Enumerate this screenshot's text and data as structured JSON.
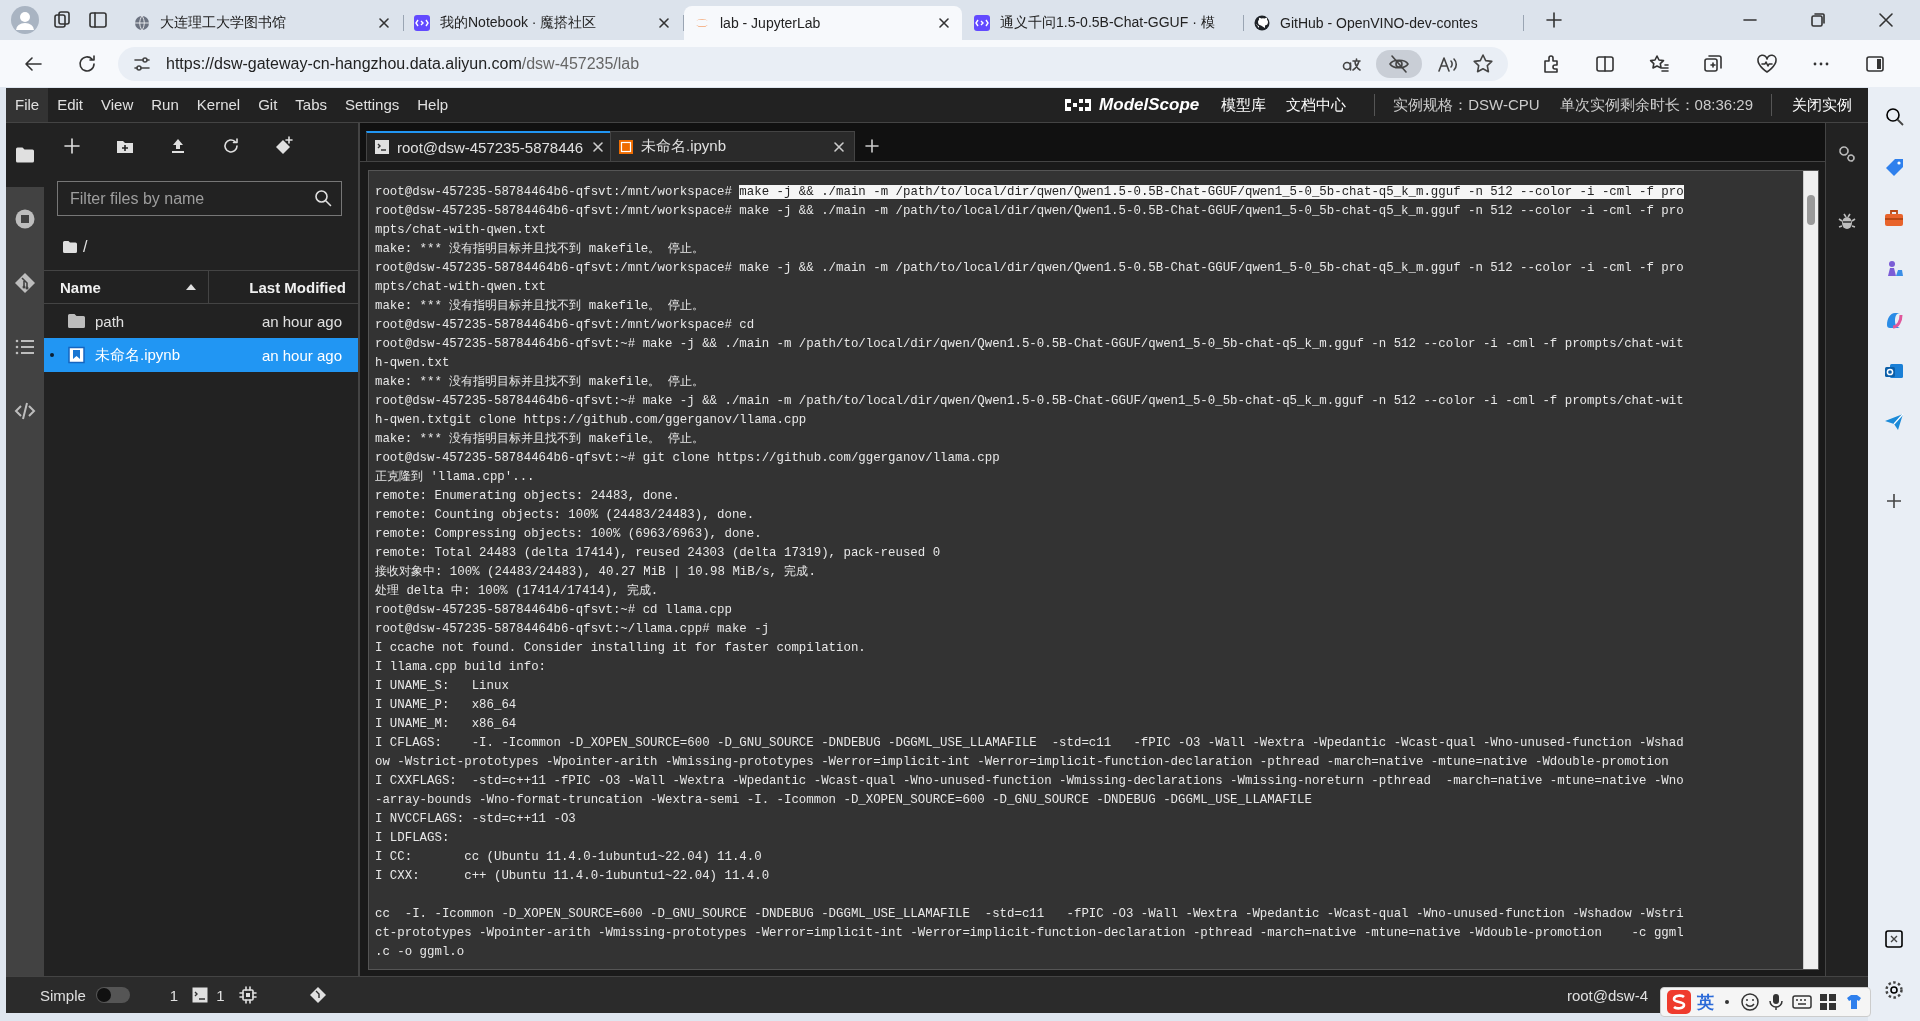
{
  "browser": {
    "tabs": [
      {
        "kind": "globe",
        "title": "大连理工大学图书馆",
        "selected": false,
        "closable": true
      },
      {
        "kind": "modelscope",
        "title": "我的Notebook · 魔搭社区",
        "selected": false,
        "closable": true
      },
      {
        "kind": "jupyter",
        "title": "lab - JupyterLab",
        "selected": true,
        "closable": true
      },
      {
        "kind": "modelscope",
        "title": "通义千问1.5-0.5B-Chat-GGUF · 模",
        "selected": false,
        "closable": false
      },
      {
        "kind": "github",
        "title": "GitHub - OpenVINO-dev-contes",
        "selected": false,
        "closable": false
      }
    ],
    "address": {
      "host": "https://dsw-gateway-cn-hangzhou.data.aliyun.com",
      "path": "/dsw-457235/lab"
    }
  },
  "menubar": {
    "items": [
      {
        "label": "File",
        "selected": true
      },
      {
        "label": "Edit",
        "selected": false
      },
      {
        "label": "View",
        "selected": false
      },
      {
        "label": "Run",
        "selected": false
      },
      {
        "label": "Kernel",
        "selected": false
      },
      {
        "label": "Git",
        "selected": false
      },
      {
        "label": "Tabs",
        "selected": false
      },
      {
        "label": "Settings",
        "selected": false
      },
      {
        "label": "Help",
        "selected": false
      }
    ],
    "brand": "ModelScope",
    "links": [
      "模型库",
      "文档中心"
    ],
    "instance_spec": "实例规格：DSW-CPU",
    "remaining_time": "单次实例剩余时长：08:36:29",
    "close_button": "关闭实例"
  },
  "left_sidebar": {
    "items": [
      {
        "kind": "folder",
        "selected": true
      },
      {
        "kind": "stop",
        "selected": false
      },
      {
        "kind": "git",
        "selected": false
      },
      {
        "kind": "list",
        "selected": false
      },
      {
        "kind": "code",
        "selected": false
      }
    ]
  },
  "file_browser": {
    "filter": {
      "placeholder": "Filter files by name"
    },
    "breadcrumb": "/",
    "columns": [
      {
        "label": "Name",
        "sorted": true
      },
      {
        "label": "Last Modified",
        "sorted": false
      }
    ],
    "rows": [
      {
        "kind": "folder",
        "name": "path",
        "modified": "an hour ago",
        "selected": false,
        "running": false
      },
      {
        "kind": "notebook",
        "name": "未命名.ipynb",
        "modified": "an hour ago",
        "selected": true,
        "running": true
      }
    ]
  },
  "dock_tabs": [
    {
      "kind": "terminal",
      "label": "root@dsw-457235-5878446",
      "selected": true
    },
    {
      "kind": "notebook",
      "label": "未命名.ipynb",
      "selected": false
    }
  ],
  "terminal": {
    "lines": [
      {
        "kind": "text",
        "text": "root@dsw-457235-58784464b6-qfsvt:/mnt/workspace# ",
        "selected_text": "make -j && ./main -m /path/to/local/dir/qwen/Qwen1.5-0.5B-Chat-GGUF/qwen1_5-0_5b-chat-q5_k_m.gguf -n 512 --color -i -cml -f pro"
      },
      {
        "kind": "text",
        "text": "root@dsw-457235-58784464b6-qfsvt:/mnt/workspace# make -j && ./main -m /path/to/local/dir/qwen/Qwen1.5-0.5B-Chat-GGUF/qwen1_5-0_5b-chat-q5_k_m.gguf -n 512 --color -i -cml -f pro"
      },
      {
        "kind": "text",
        "text": "mpts/chat-with-qwen.txt"
      },
      {
        "kind": "text",
        "text": "make: *** 没有指明目标并且找不到 makefile。 停止。"
      },
      {
        "kind": "text",
        "text": "root@dsw-457235-58784464b6-qfsvt:/mnt/workspace# make -j && ./main -m /path/to/local/dir/qwen/Qwen1.5-0.5B-Chat-GGUF/qwen1_5-0_5b-chat-q5_k_m.gguf -n 512 --color -i -cml -f pro"
      },
      {
        "kind": "text",
        "text": "mpts/chat-with-qwen.txt"
      },
      {
        "kind": "text",
        "text": "make: *** 没有指明目标并且找不到 makefile。 停止。"
      },
      {
        "kind": "text",
        "text": "root@dsw-457235-58784464b6-qfsvt:/mnt/workspace# cd"
      },
      {
        "kind": "text",
        "text": "root@dsw-457235-58784464b6-qfsvt:~# make -j && ./main -m /path/to/local/dir/qwen/Qwen1.5-0.5B-Chat-GGUF/qwen1_5-0_5b-chat-q5_k_m.gguf -n 512 --color -i -cml -f prompts/chat-wit"
      },
      {
        "kind": "text",
        "text": "h-qwen.txt"
      },
      {
        "kind": "text",
        "text": "make: *** 没有指明目标并且找不到 makefile。 停止。"
      },
      {
        "kind": "text",
        "text": "root@dsw-457235-58784464b6-qfsvt:~# make -j && ./main -m /path/to/local/dir/qwen/Qwen1.5-0.5B-Chat-GGUF/qwen1_5-0_5b-chat-q5_k_m.gguf -n 512 --color -i -cml -f prompts/chat-wit"
      },
      {
        "kind": "text",
        "text": "h-qwen.txtgit clone https://github.com/ggerganov/llama.cpp"
      },
      {
        "kind": "text",
        "text": "make: *** 没有指明目标并且找不到 makefile。 停止。"
      },
      {
        "kind": "text",
        "text": "root@dsw-457235-58784464b6-qfsvt:~# git clone https://github.com/ggerganov/llama.cpp"
      },
      {
        "kind": "text",
        "text": "正克隆到 'llama.cpp'..."
      },
      {
        "kind": "text",
        "text": "remote: Enumerating objects: 24483, done."
      },
      {
        "kind": "text",
        "text": "remote: Counting objects: 100% (24483/24483), done."
      },
      {
        "kind": "text",
        "text": "remote: Compressing objects: 100% (6963/6963), done."
      },
      {
        "kind": "text",
        "text": "remote: Total 24483 (delta 17414), reused 24303 (delta 17319), pack-reused 0"
      },
      {
        "kind": "text",
        "text": "接收对象中: 100% (24483/24483), 40.27 MiB | 10.98 MiB/s, 完成."
      },
      {
        "kind": "text",
        "text": "处理 delta 中: 100% (17414/17414), 完成."
      },
      {
        "kind": "text",
        "text": "root@dsw-457235-58784464b6-qfsvt:~# cd llama.cpp"
      },
      {
        "kind": "text",
        "text": "root@dsw-457235-58784464b6-qfsvt:~/llama.cpp# make -j"
      },
      {
        "kind": "text",
        "text": "I ccache not found. Consider installing it for faster compilation."
      },
      {
        "kind": "text",
        "text": "I llama.cpp build info:"
      },
      {
        "kind": "text",
        "text": "I UNAME_S:   Linux"
      },
      {
        "kind": "text",
        "text": "I UNAME_P:   x86_64"
      },
      {
        "kind": "text",
        "text": "I UNAME_M:   x86_64"
      },
      {
        "kind": "text",
        "text": "I CFLAGS:    -I. -Icommon -D_XOPEN_SOURCE=600 -D_GNU_SOURCE -DNDEBUG -DGGML_USE_LLAMAFILE  -std=c11   -fPIC -O3 -Wall -Wextra -Wpedantic -Wcast-qual -Wno-unused-function -Wshad"
      },
      {
        "kind": "text",
        "text": "ow -Wstrict-prototypes -Wpointer-arith -Wmissing-prototypes -Werror=implicit-int -Werror=implicit-function-declaration -pthread -march=native -mtune=native -Wdouble-promotion"
      },
      {
        "kind": "text",
        "text": "I CXXFLAGS:  -std=c++11 -fPIC -O3 -Wall -Wextra -Wpedantic -Wcast-qual -Wno-unused-function -Wmissing-declarations -Wmissing-noreturn -pthread  -march=native -mtune=native -Wno"
      },
      {
        "kind": "text",
        "text": "-array-bounds -Wno-format-truncation -Wextra-semi -I. -Icommon -D_XOPEN_SOURCE=600 -D_GNU_SOURCE -DNDEBUG -DGGML_USE_LLAMAFILE"
      },
      {
        "kind": "text",
        "text": "I NVCCFLAGS: -std=c++11 -O3"
      },
      {
        "kind": "text",
        "text": "I LDFLAGS:"
      },
      {
        "kind": "text",
        "text": "I CC:       cc (Ubuntu 11.4.0-1ubuntu1~22.04) 11.4.0"
      },
      {
        "kind": "text",
        "text": "I CXX:      c++ (Ubuntu 11.4.0-1ubuntu1~22.04) 11.4.0"
      },
      {
        "kind": "blank"
      },
      {
        "kind": "text",
        "text": "cc  -I. -Icommon -D_XOPEN_SOURCE=600 -D_GNU_SOURCE -DNDEBUG -DGGML_USE_LLAMAFILE  -std=c11   -fPIC -O3 -Wall -Wextra -Wpedantic -Wcast-qual -Wno-unused-function -Wshadow -Wstri"
      },
      {
        "kind": "text",
        "text": "ct-prototypes -Wpointer-arith -Wmissing-prototypes -Werror=implicit-int -Werror=implicit-function-declaration -pthread -march=native -mtune=native -Wdouble-promotion    -c ggml"
      },
      {
        "kind": "text",
        "text": ".c -o ggml.o"
      }
    ]
  },
  "status_bar": {
    "mode_label": "Simple",
    "simple_mode": false,
    "kernels": "1",
    "terminals": "1",
    "user": "root@dsw-4"
  },
  "ime": {
    "mode": "英"
  }
}
